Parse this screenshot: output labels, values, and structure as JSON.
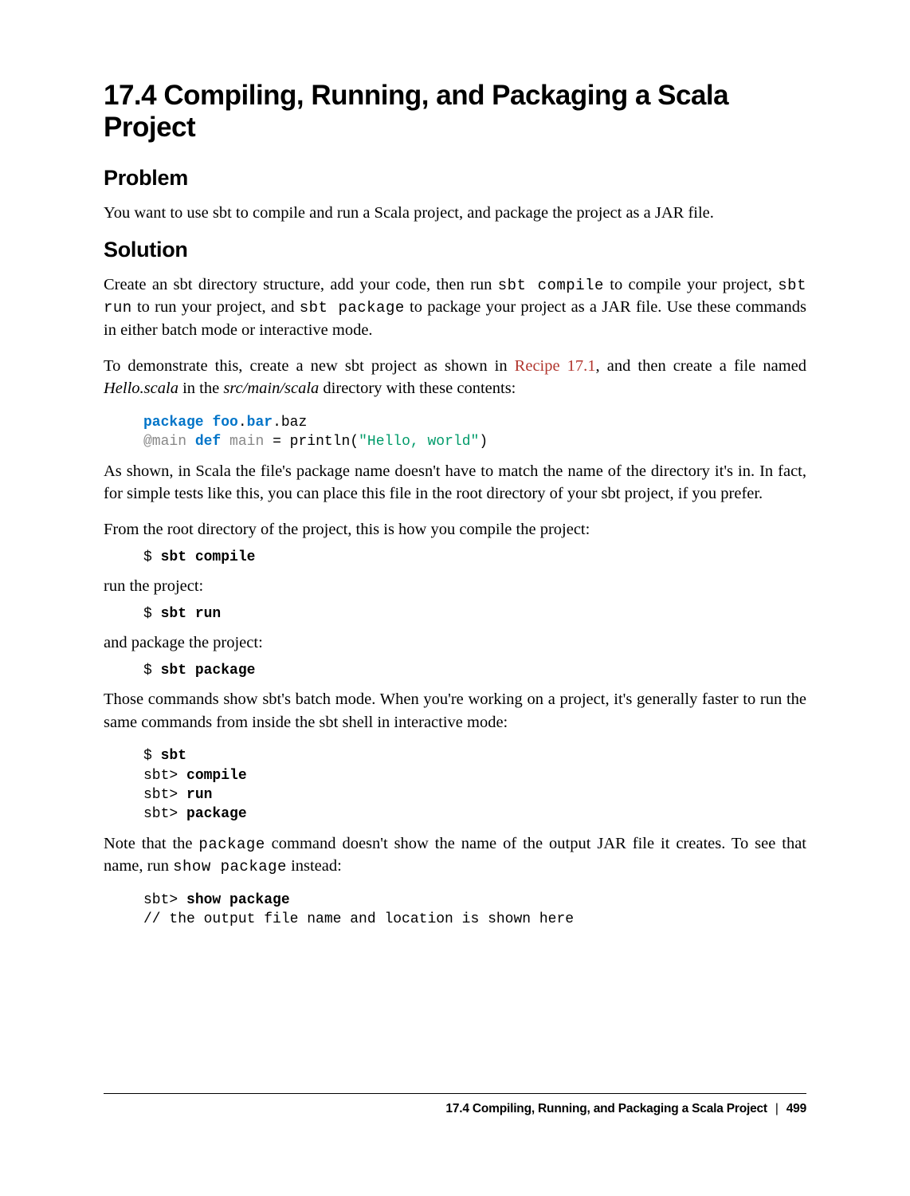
{
  "title": "17.4 Compiling, Running, and Packaging a Scala Project",
  "problem": {
    "heading": "Problem",
    "text": "You want to use sbt to compile and run a Scala project, and package the project as a JAR file."
  },
  "solution": {
    "heading": "Solution",
    "p1_pre": "Create an sbt directory structure, add your code, then run ",
    "p1_code1": "sbt compile",
    "p1_mid1": " to compile your project, ",
    "p1_code2": "sbt run",
    "p1_mid2": " to run your project, and ",
    "p1_code3": "sbt package",
    "p1_end": " to package your project as a JAR file. Use these commands in either batch mode or interactive mode.",
    "p2_pre": "To demonstrate this, create a new sbt project as shown in ",
    "p2_link": "Recipe 17.1",
    "p2_mid": ", and then create a file named ",
    "p2_file": "Hello.scala",
    "p2_mid2": " in the ",
    "p2_dir": "src/main/scala",
    "p2_end": " directory with these contents:",
    "code1": {
      "kw_package": "package",
      "foo": "foo",
      "dot1": ".",
      "bar": "bar",
      "dot2": ".",
      "baz": "baz",
      "ann": "@main",
      "kw_def": "def",
      "fn": "main",
      "eq": " = println(",
      "str": "\"Hello, world\"",
      "close": ")"
    },
    "p3": "As shown, in Scala the file's package name doesn't have to match the name of the directory it's in. In fact, for simple tests like this, you can place this file in the root directory of your sbt project, if you prefer.",
    "p4": "From the root directory of the project, this is how you compile the project:",
    "cmd1_prompt": "$ ",
    "cmd1": "sbt compile",
    "p5": "run the project:",
    "cmd2_prompt": "$ ",
    "cmd2": "sbt run",
    "p6": "and package the project:",
    "cmd3_prompt": "$ ",
    "cmd3": "sbt package",
    "p7": "Those commands show sbt's batch mode. When you're working on a project, it's generally faster to run the same commands from inside the sbt shell in interactive mode:",
    "int_prompt1": "$ ",
    "int_cmd1": "sbt",
    "int_prompt2": "sbt> ",
    "int_cmd2": "compile",
    "int_prompt3": "sbt> ",
    "int_cmd3": "run",
    "int_prompt4": "sbt> ",
    "int_cmd4": "package",
    "p8_pre": "Note that the ",
    "p8_code1": "package",
    "p8_mid": " command doesn't show the name of the output JAR file it creates. To see that name, run ",
    "p8_code2": "show package",
    "p8_end": " instead:",
    "show_prompt": "sbt> ",
    "show_cmd": "show package",
    "show_comment": "// the output file name and location is shown here"
  },
  "footer": {
    "title": "17.4 Compiling, Running, and Packaging a Scala Project",
    "sep": "|",
    "page": "499"
  }
}
